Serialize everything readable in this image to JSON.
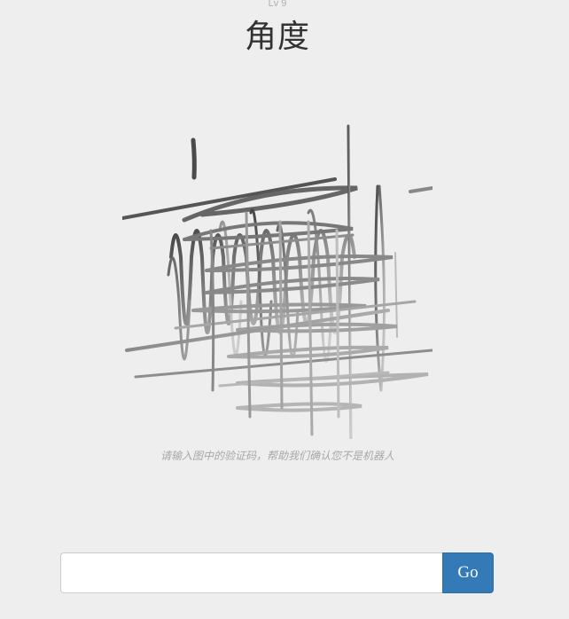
{
  "header": {
    "level": "Lv 9",
    "title": "角度"
  },
  "captcha": {
    "hint": "请输入图中的验证码，帮助我们确认您不是机器人"
  },
  "form": {
    "input_value": "",
    "input_placeholder": "",
    "submit_label": "Go"
  },
  "colors": {
    "background": "#eeeeee",
    "button": "#337ab7",
    "button_text": "#ffffff",
    "title": "#333333",
    "hint": "#a8a8a8"
  }
}
